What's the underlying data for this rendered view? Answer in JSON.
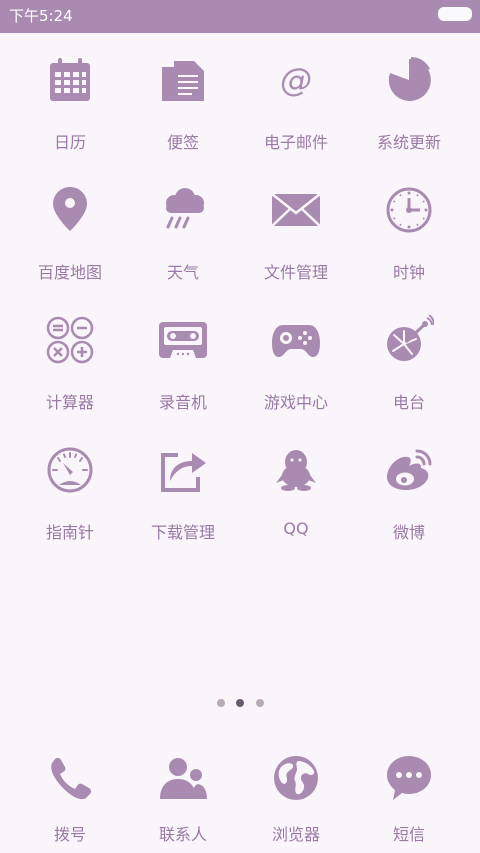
{
  "status": {
    "time": "下午5:24"
  },
  "colors": {
    "accent": "#a98bb1",
    "label": "#9a7aa5",
    "background": "#faf5fa"
  },
  "apps": [
    {
      "label": "日历",
      "icon": "calendar-icon"
    },
    {
      "label": "便签",
      "icon": "notes-icon"
    },
    {
      "label": "电子邮件",
      "icon": "email-icon"
    },
    {
      "label": "系统更新",
      "icon": "update-icon"
    },
    {
      "label": "百度地图",
      "icon": "map-pin-icon"
    },
    {
      "label": "天气",
      "icon": "weather-icon"
    },
    {
      "label": "文件管理",
      "icon": "folder-mail-icon"
    },
    {
      "label": "时钟",
      "icon": "clock-icon"
    },
    {
      "label": "计算器",
      "icon": "calculator-icon"
    },
    {
      "label": "录音机",
      "icon": "cassette-icon"
    },
    {
      "label": "游戏中心",
      "icon": "gamepad-icon"
    },
    {
      "label": "电台",
      "icon": "radio-icon"
    },
    {
      "label": "指南针",
      "icon": "compass-icon"
    },
    {
      "label": "下载管理",
      "icon": "download-share-icon"
    },
    {
      "label": "QQ",
      "icon": "qq-penguin-icon"
    },
    {
      "label": "微博",
      "icon": "weibo-icon"
    }
  ],
  "dock": [
    {
      "label": "拨号",
      "icon": "phone-icon"
    },
    {
      "label": "联系人",
      "icon": "contacts-icon"
    },
    {
      "label": "浏览器",
      "icon": "globe-icon"
    },
    {
      "label": "短信",
      "icon": "message-icon"
    }
  ],
  "pager": {
    "page_count": 3,
    "current_page": 2
  }
}
